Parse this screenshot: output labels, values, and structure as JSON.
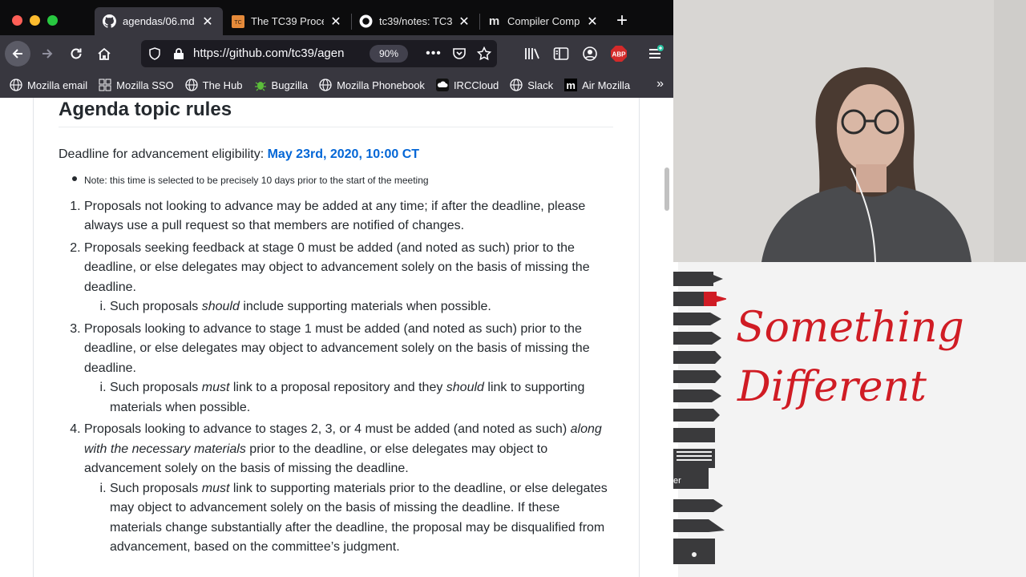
{
  "tabs": [
    {
      "title": "agendas/06.md",
      "icon": "github-icon",
      "active": true
    },
    {
      "title": "The TC39 Proce",
      "icon": "tc39-icon",
      "active": false
    },
    {
      "title": "tc39/notes: TC3",
      "icon": "github-icon",
      "active": false
    },
    {
      "title": "Compiler Comp",
      "icon": "medium-icon",
      "active": false
    }
  ],
  "toolbar": {
    "url_host": "https://github.com/tc39/agen",
    "zoom": "90%",
    "abp_label": "ABP"
  },
  "bookmarks": [
    {
      "label": "Mozilla email",
      "icon": "globe-icon"
    },
    {
      "label": "Mozilla SSO",
      "icon": "grid-icon"
    },
    {
      "label": "The Hub",
      "icon": "globe-icon"
    },
    {
      "label": "Bugzilla",
      "icon": "bug-icon"
    },
    {
      "label": "Mozilla Phonebook",
      "icon": "globe-icon"
    },
    {
      "label": "IRCCloud",
      "icon": "cloud-icon"
    },
    {
      "label": "Slack",
      "icon": "globe-icon"
    },
    {
      "label": "Air Mozilla",
      "icon": "m-icon"
    }
  ],
  "page": {
    "heading": "Agenda topic rules",
    "deadline_prefix": "Deadline for advancement eligibility: ",
    "deadline_link": "May 23rd, 2020, 10:00 CT",
    "note": "Note: this time is selected to be precisely 10 days prior to the start of the meeting",
    "rule1": "Proposals not looking to advance may be added at any time; if after the deadline, please always use a pull request so that members are notified of changes.",
    "rule2": "Proposals seeking feedback at stage 0 must be added (and noted as such) prior to the deadline, or else delegates may object to advancement solely on the basis of missing the deadline.",
    "rule2_sub_a": "Such proposals ",
    "rule2_sub_em": "should",
    "rule2_sub_b": " include supporting materials when possible.",
    "rule3": "Proposals looking to advance to stage 1 must be added (and noted as such) prior to the deadline, or else delegates may object to advancement solely on the basis of missing the deadline.",
    "rule3_sub_a": "Such proposals ",
    "rule3_sub_em1": "must",
    "rule3_sub_b": " link to a proposal repository and they ",
    "rule3_sub_em2": "should",
    "rule3_sub_c": " link to supporting materials when possible.",
    "rule4_a": "Proposals looking to advance to stages 2, 3, or 4 must be added (and noted as such) ",
    "rule4_em": "along with the necessary materials",
    "rule4_b": " prior to the deadline, or else delegates may object to advancement solely on the basis of missing the deadline.",
    "rule4_sub_a": "Such proposals ",
    "rule4_sub_em": "must",
    "rule4_sub_b": " link to supporting materials prior to the deadline, or else delegates may object to advancement solely on the basis of missing the deadline. If these materials change substantially after the deadline, the proposal may be disqualified from advancement, based on the committee’s judgment."
  },
  "whiteboard": {
    "line1": "Something",
    "line2": "Different",
    "ink_color": "#d01c24",
    "palette_label": "er"
  }
}
